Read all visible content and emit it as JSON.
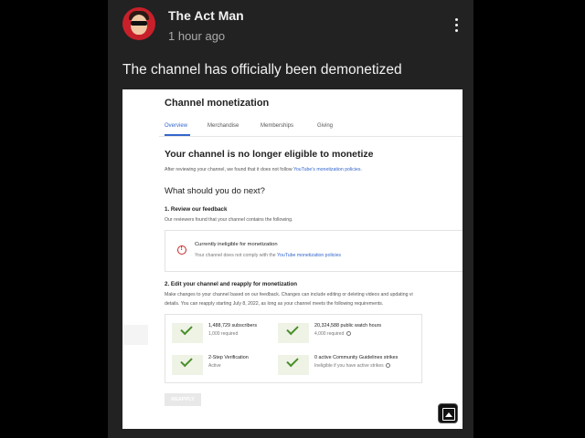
{
  "post": {
    "author": "The Act Man",
    "time": "1 hour ago",
    "text": "The channel has officially been demonetized"
  },
  "screenshot": {
    "title": "Channel monetization",
    "tabs": [
      "Overview",
      "Merchandise",
      "Memberships",
      "Giving"
    ],
    "active_tab": "Overview",
    "heading": "Your channel is no longer eligible to monetize",
    "intro_prefix": "After reviewing your channel, we found that it does not follow",
    "intro_link": "YouTube's monetization policies",
    "intro_suffix": ".",
    "next_heading": "What should you do next?",
    "step1_title": "1. Review our feedback",
    "step1_text": "Our reviewers found that your channel contains the following.",
    "alert_title": "Currently ineligible for monetization",
    "alert_prefix": "Your channel does not comply with the",
    "alert_link": "YouTube monetization policies",
    "step2_title": "2. Edit your channel and reapply for monetization",
    "step2_line1": "Make changes to your channel based on our feedback. Changes can include editing or deleting videos and updating vi",
    "step2_line2": "details. You can reapply starting July 8, 2022, as long as your channel meets the following requirements.",
    "requirements": [
      {
        "title": "1,488,729 subscribers",
        "sub": "1,000 required",
        "info": false
      },
      {
        "title": "20,324,588 public watch hours",
        "sub": "4,000 required",
        "info": true
      },
      {
        "title": "2-Step Verification",
        "sub": "Active",
        "info": false
      },
      {
        "title": "0 active Community Guidelines strikes",
        "sub": "Ineligible if you have active strikes",
        "info": true
      }
    ],
    "reapply_label": "REAPPLY"
  },
  "icons": {
    "menu": "more-vert-icon",
    "alert": "error-circle-icon",
    "check": "check-icon",
    "info": "info-icon",
    "gallery": "image-gallery-icon"
  },
  "colors": {
    "post_bg": "#222222",
    "link": "#3366cc",
    "alert": "#c62828",
    "check": "#4a8f2a"
  }
}
